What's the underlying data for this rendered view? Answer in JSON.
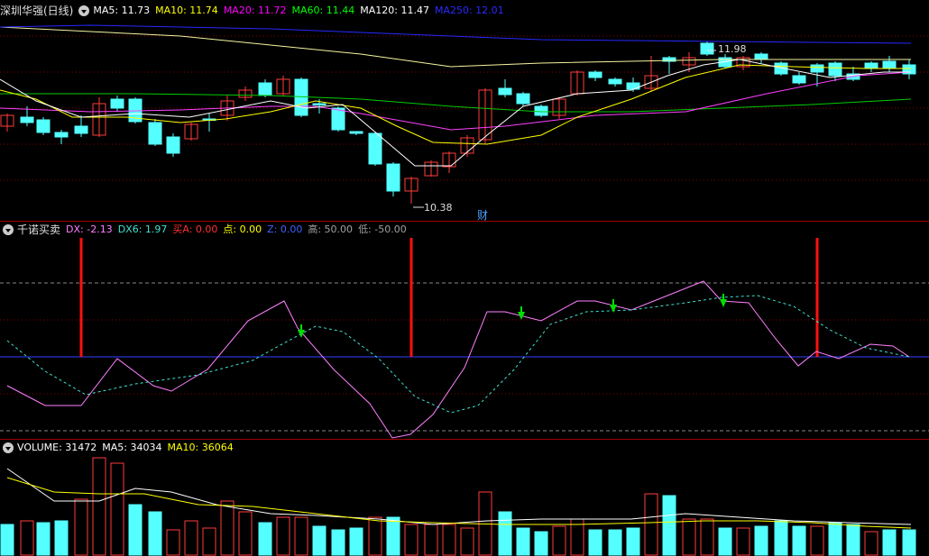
{
  "main": {
    "stock_name": "深圳华强(日线)",
    "ma": [
      {
        "label": "MA5: 11.73",
        "color": "#ffffff"
      },
      {
        "label": "MA10: 11.74",
        "color": "#ffff00"
      },
      {
        "label": "MA20: 11.72",
        "color": "#ff00ff"
      },
      {
        "label": "MA60: 11.44",
        "color": "#00ff00"
      },
      {
        "label": "MA120: 11.47",
        "color": "#ffffff"
      },
      {
        "label": "MA250: 12.01",
        "color": "#2020ff"
      }
    ],
    "high_label": "11.98",
    "low_label": "10.38",
    "fin_badge": "财"
  },
  "indicator": {
    "name": "千诺买卖",
    "items": [
      {
        "label": "DX: -2.13",
        "color": "#ff80ff"
      },
      {
        "label": "DX6: 1.97",
        "color": "#40e0d0"
      },
      {
        "label": "买A: 0.00",
        "color": "#ff3030"
      },
      {
        "label": "点: 0.00",
        "color": "#ffff00"
      },
      {
        "label": "Z: 0.00",
        "color": "#4060ff"
      },
      {
        "label": "高: 50.00",
        "color": "#a0a0a0"
      },
      {
        "label": "低: -50.00",
        "color": "#a0a0a0"
      }
    ]
  },
  "volume": {
    "items": [
      {
        "label": "VOLUME: 31472",
        "color": "#ffffff"
      },
      {
        "label": "MA5: 34034",
        "color": "#ffffff"
      },
      {
        "label": "MA10: 36064",
        "color": "#ffff00"
      }
    ]
  },
  "colors": {
    "up": "#ff3c3c",
    "down": "#54ffff",
    "grid": "#8a0000"
  }
}
